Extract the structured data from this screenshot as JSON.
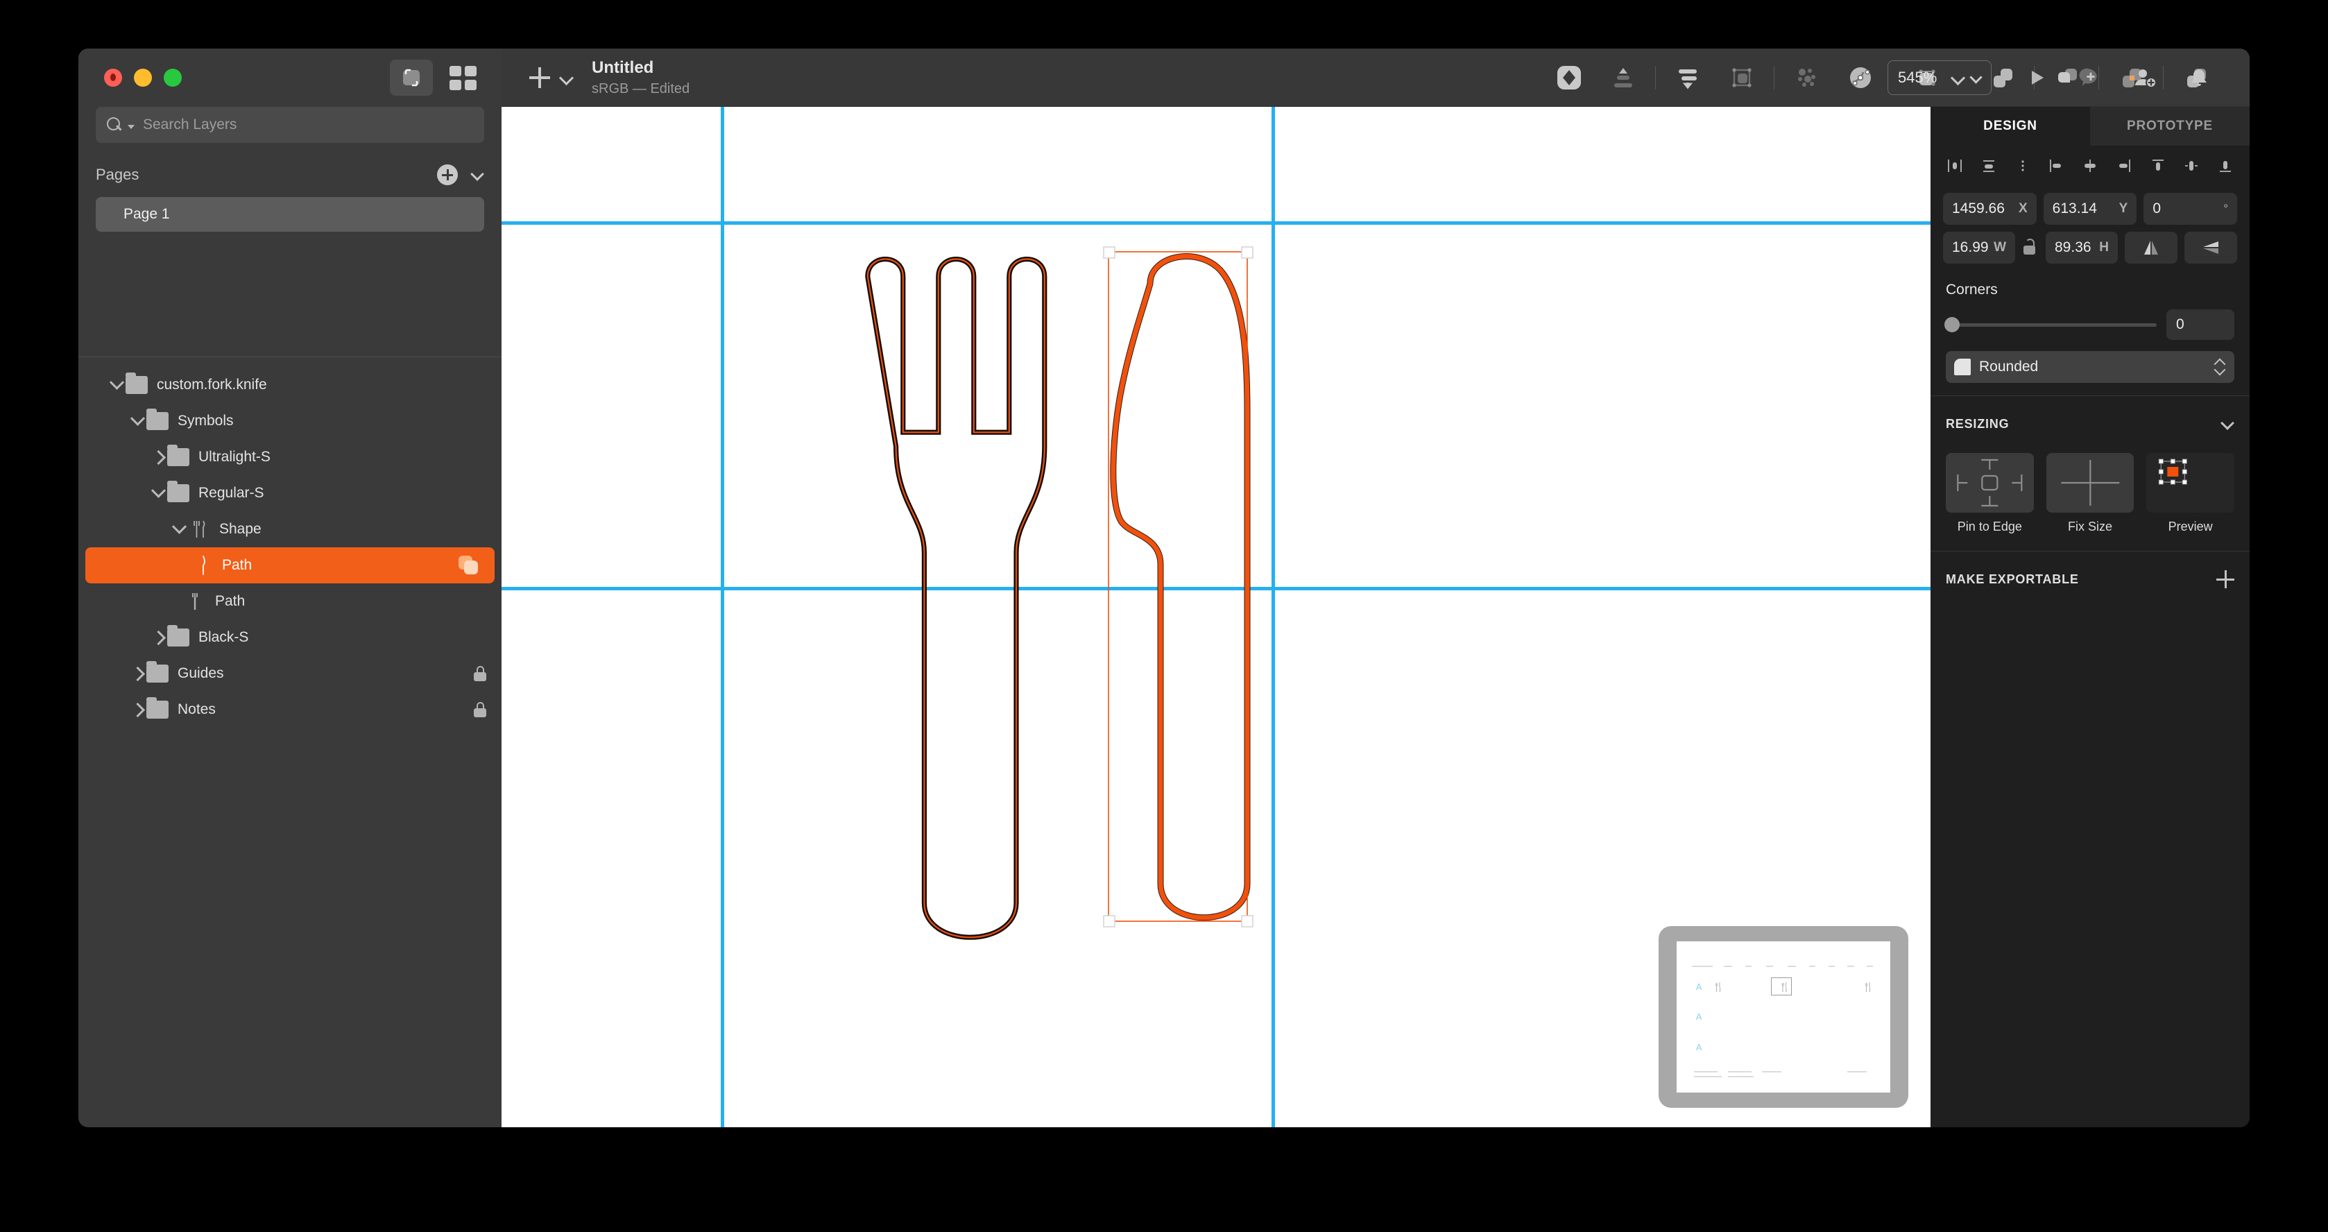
{
  "window": {
    "traffic_lights": [
      "close",
      "minimize",
      "zoom"
    ]
  },
  "toolbar": {
    "insert_label": "Insert",
    "doc_title": "Untitled",
    "doc_subtitle": "sRGB — Edited",
    "zoom_level": "545%",
    "icons": [
      "mask-icon",
      "align-up-icon",
      "distribute-icon",
      "group-icon",
      "scatter-points-icon",
      "edit-path-icon",
      "transform-icon",
      "union-icon",
      "subtract-icon",
      "intersect-icon",
      "difference-icon"
    ],
    "right_icons": [
      "play-icon",
      "comment-add-icon",
      "invite-person-icon",
      "bell-icon"
    ]
  },
  "sidebar": {
    "view_toggle": "canvas-view-icon",
    "grid_toggle": "grid-view-icon",
    "search": {
      "placeholder": "Search Layers",
      "value": ""
    },
    "pages": {
      "title": "Pages",
      "add_label": "add-page",
      "items": [
        {
          "label": "Page 1",
          "selected": true
        }
      ]
    },
    "layers": [
      {
        "label": "custom.fork.knife",
        "depth": 0,
        "type": "folder",
        "expanded": true,
        "selected": false,
        "locked": false
      },
      {
        "label": "Symbols",
        "depth": 1,
        "type": "folder",
        "expanded": true,
        "selected": false,
        "locked": false
      },
      {
        "label": "Ultralight-S",
        "depth": 2,
        "type": "folder",
        "expanded": false,
        "selected": false,
        "locked": false
      },
      {
        "label": "Regular-S",
        "depth": 2,
        "type": "folder",
        "expanded": true,
        "selected": false,
        "locked": false
      },
      {
        "label": "Shape",
        "depth": 3,
        "type": "shape-forkknife",
        "expanded": true,
        "selected": false,
        "locked": false
      },
      {
        "label": "Path",
        "depth": 4,
        "type": "shape-knife",
        "expanded": null,
        "selected": true,
        "locked": false,
        "badge": "duplicate-icon"
      },
      {
        "label": "Path",
        "depth": 4,
        "type": "shape-fork",
        "expanded": null,
        "selected": false,
        "locked": false
      },
      {
        "label": "Black-S",
        "depth": 2,
        "type": "folder",
        "expanded": false,
        "selected": false,
        "locked": false
      },
      {
        "label": "Guides",
        "depth": 1,
        "type": "folder",
        "expanded": false,
        "selected": false,
        "locked": true
      },
      {
        "label": "Notes",
        "depth": 1,
        "type": "folder",
        "expanded": false,
        "selected": false,
        "locked": true
      }
    ]
  },
  "canvas": {
    "background": "#ffffff",
    "guide_color": "#26b0f0",
    "selection_color": "#f25f19",
    "stroke_color": "#1a1008",
    "guides": {
      "vertical_x": [
        316,
        1110
      ],
      "horizontal_y": [
        165,
        692
      ]
    },
    "shapes": [
      {
        "name": "fork-path",
        "selected": false
      },
      {
        "name": "knife-path",
        "selected": true
      }
    ],
    "minimap": {
      "name": "document-minimap"
    }
  },
  "inspector": {
    "tabs": [
      {
        "label": "DESIGN",
        "active": true
      },
      {
        "label": "PROTOTYPE",
        "active": false
      }
    ],
    "align_icons": [
      "align-left-icon",
      "align-center-horizontal-icon",
      "distribute-vertical-icon",
      "align-left-edge-icon",
      "align-horizontal-center-icon",
      "align-right-edge-icon",
      "align-top-icon",
      "align-middle-icon",
      "align-bottom-icon"
    ],
    "position": {
      "x_value": "1459.66",
      "x_unit": "X",
      "y_value": "613.14",
      "y_unit": "Y",
      "rotation_value": "0",
      "rotation_unit": "°"
    },
    "size": {
      "w_value": "16.99",
      "w_unit": "W",
      "h_value": "89.36",
      "h_unit": "H",
      "lock_state": "unlocked",
      "flip_horizontal": "flip-horizontal-icon",
      "flip_vertical": "flip-vertical-icon"
    },
    "corners": {
      "title": "Corners",
      "radius_value": "0",
      "slider_percent": 0,
      "style_label": "Rounded"
    },
    "resizing": {
      "title": "RESIZING",
      "options": [
        {
          "label": "Pin to Edge",
          "icon": "pin-to-edge-icon"
        },
        {
          "label": "Fix Size",
          "icon": "fix-size-icon"
        },
        {
          "label": "Preview",
          "icon": "resize-preview-icon"
        }
      ]
    },
    "make_exportable": {
      "title": "MAKE EXPORTABLE",
      "add": "add-export-preset"
    }
  }
}
